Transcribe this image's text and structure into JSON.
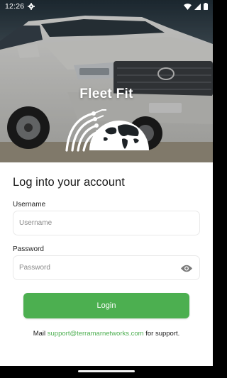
{
  "status_bar": {
    "time": "12:26",
    "icons": [
      "settings-icon",
      "wifi-icon",
      "cellular-signal-icon",
      "battery-icon"
    ]
  },
  "hero": {
    "brand_name": "Fleet Fit",
    "logo": "globe-network-icon"
  },
  "login": {
    "heading": "Log into your account",
    "username_label": "Username",
    "username_placeholder": "Username",
    "username_value": "",
    "password_label": "Password",
    "password_placeholder": "Password",
    "password_value": "",
    "show_password_icon": "eye-icon",
    "login_button": "Login",
    "support_prefix": "Mail ",
    "support_email": "support@terramarnetworks.com",
    "support_suffix": " for support."
  },
  "colors": {
    "accent": "#4caf50",
    "text": "#1a1a1a",
    "field_border": "#e9e9e9"
  }
}
